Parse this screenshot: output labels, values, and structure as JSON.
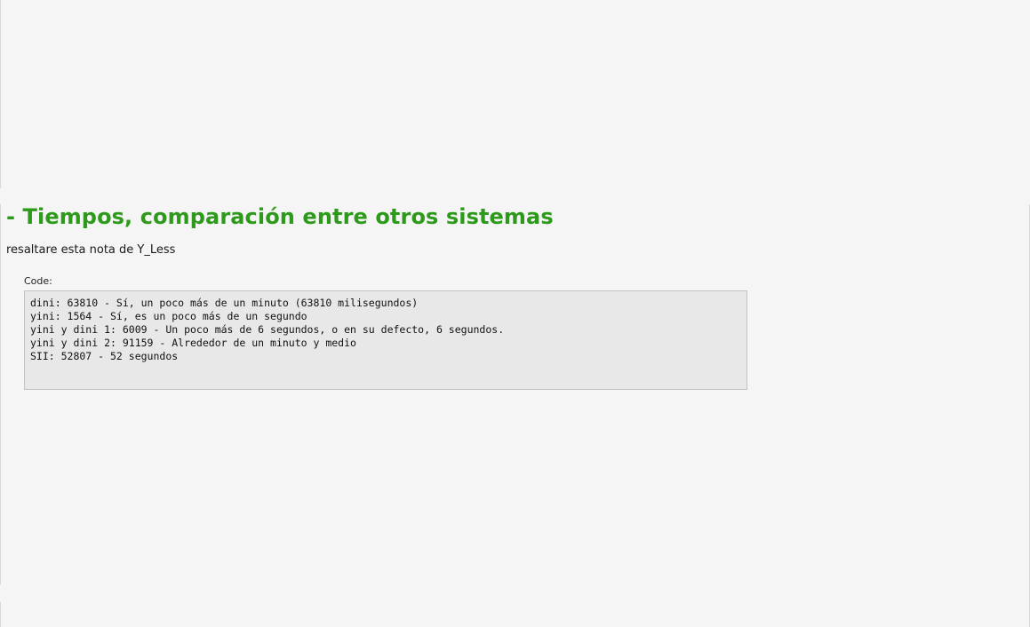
{
  "post": {
    "title": "- Tiempos, comparación entre otros sistemas",
    "text": "resaltare esta nota de Y_Less",
    "code": {
      "label": "Code:",
      "lines": [
        "dini: 63810 - Sí, un poco más de un minuto (63810 milisegundos)",
        "yini: 1564 - Sí, es un poco más de un segundo",
        "yini y dini 1: 6009 - Un poco más de 6 segundos, o en su defecto, 6 segundos.",
        "yini y dini 2: 91159 - Alrededor de un minuto y medio",
        "SII: 52807 - 52 segundos"
      ]
    }
  },
  "colors": {
    "background": "#f5f5f5",
    "title": "#2e9a1c",
    "code_background": "#e8e8e8",
    "code_border": "#c3c3c3"
  }
}
